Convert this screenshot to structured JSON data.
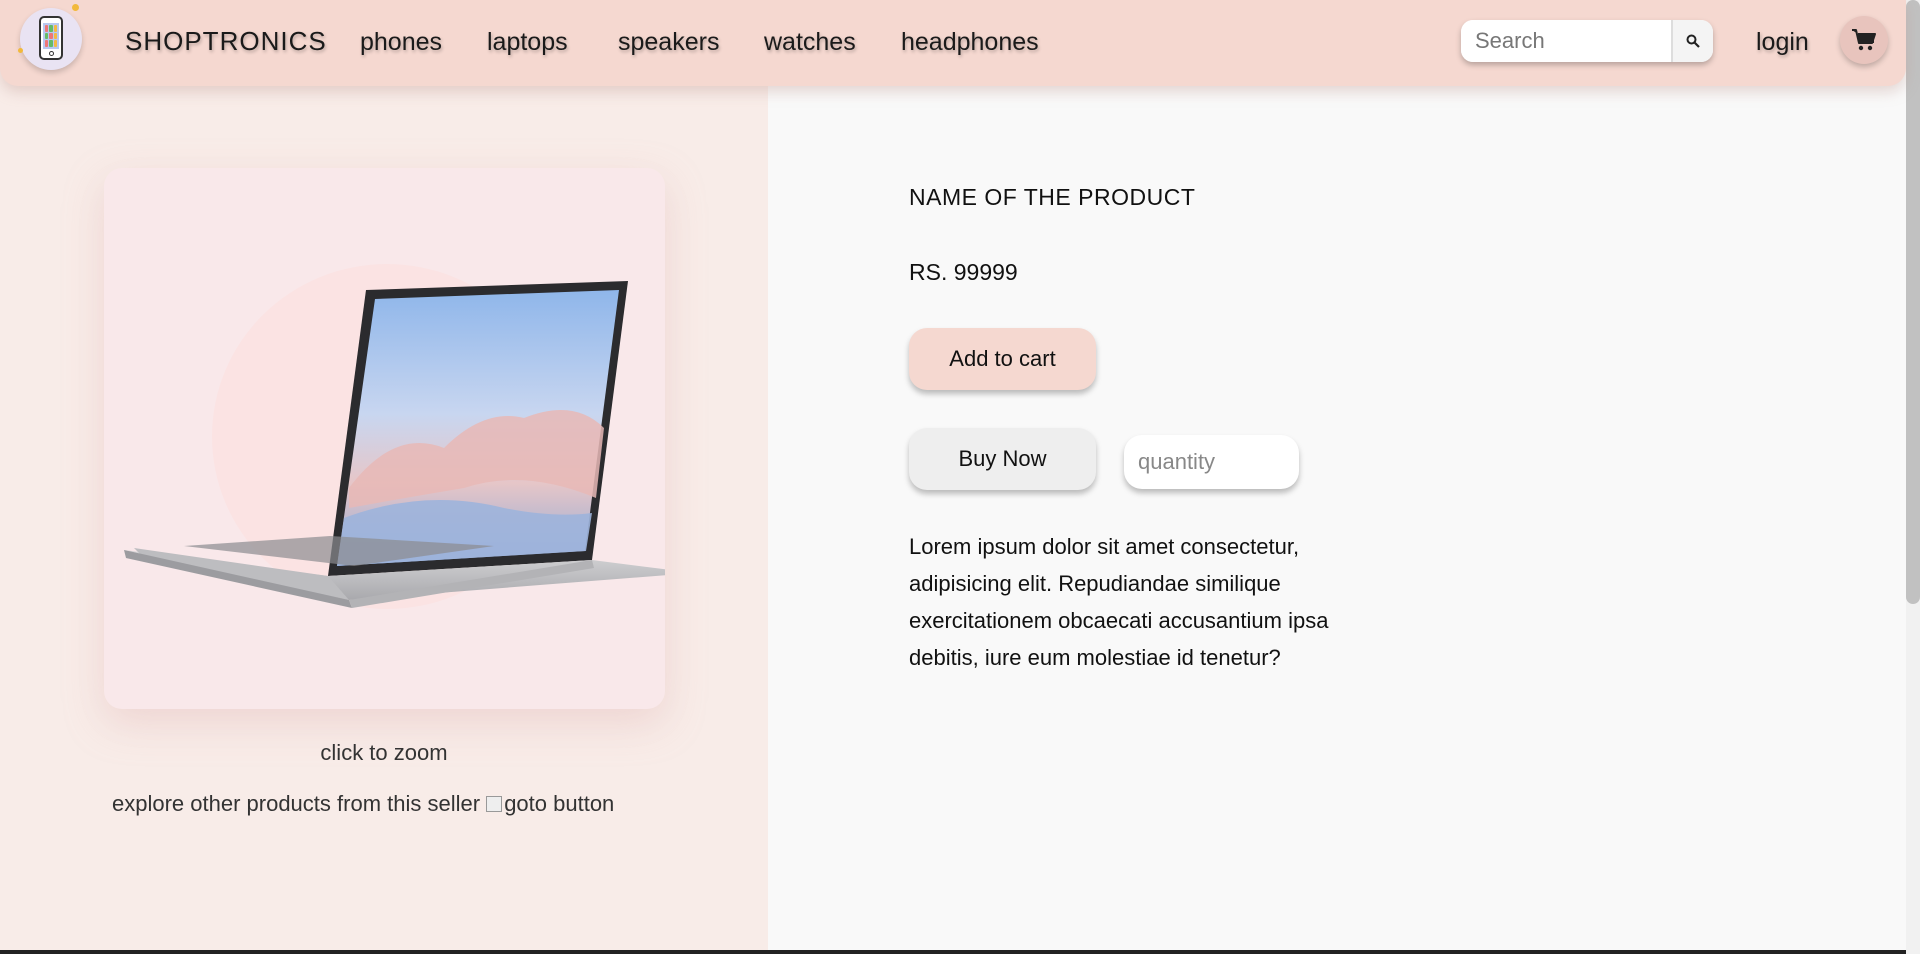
{
  "header": {
    "logo_icon": "phone-logo-icon",
    "brand": "SHOPTRONICS",
    "nav": [
      "phones",
      "laptops",
      "speakers",
      "watches",
      "headphones"
    ],
    "search": {
      "placeholder": "Search",
      "icon": "search-icon"
    },
    "login": "login",
    "cart_icon": "cart-icon"
  },
  "gallery": {
    "image": "laptop-product-image",
    "zoom_label": "click to zoom",
    "explore_text": "explore other products from this seller",
    "goto_alt": "goto button"
  },
  "product": {
    "name": "NAME OF THE PRODUCT",
    "price": "RS. 99999",
    "add_to_cart": "Add to cart",
    "buy_now": "Buy Now",
    "quantity_placeholder": "quantity",
    "description": "Lorem ipsum dolor sit amet consectetur, adipisicing elit. Repudiandae similique exercitationem obcaecati accusantium ipsa debitis, iure eum molestiae id tenetur?"
  },
  "colors": {
    "navbar": "#f5d8d0",
    "left_panel": "#f8ece8",
    "card": "#f9e8ea",
    "add_to_cart": "#f5d8d0",
    "buy_now": "#eeeeee"
  }
}
